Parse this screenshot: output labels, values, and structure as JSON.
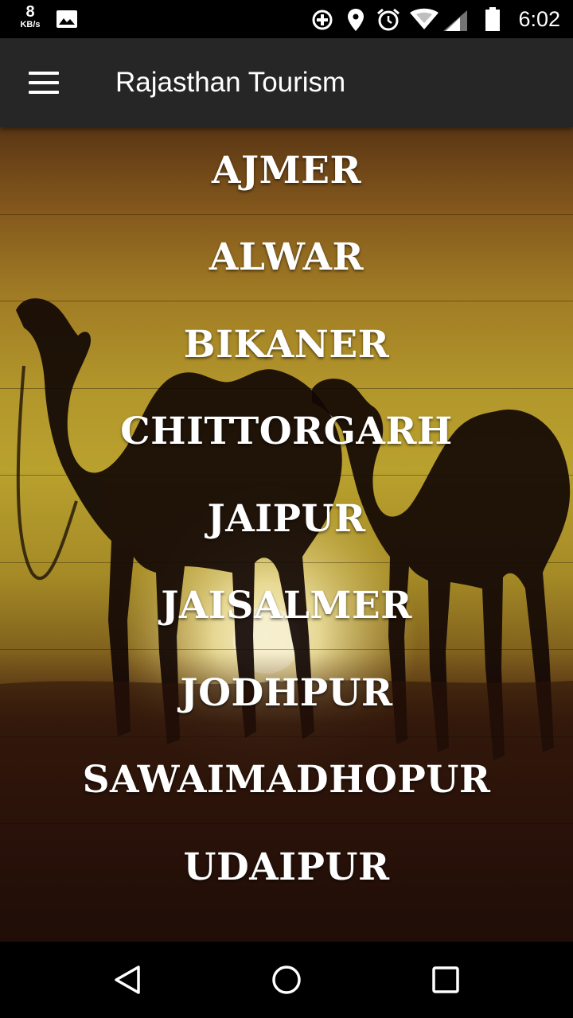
{
  "status_bar": {
    "net_speed_value": "8",
    "net_speed_unit": "KB/s",
    "time": "6:02",
    "icons": [
      "image-icon",
      "data-saver-icon",
      "location-icon",
      "alarm-icon",
      "wifi-icon",
      "signal-icon",
      "battery-icon"
    ]
  },
  "app_bar": {
    "title": "Rajasthan Tourism",
    "menu_icon": "hamburger-menu-icon"
  },
  "cities": [
    {
      "label": "AJMER"
    },
    {
      "label": "ALWAR"
    },
    {
      "label": "BIKANER"
    },
    {
      "label": "CHITTORGARH"
    },
    {
      "label": "JAIPUR"
    },
    {
      "label": "JAISALMER"
    },
    {
      "label": "JODHPUR"
    },
    {
      "label": "SAWAIMADHOPUR"
    },
    {
      "label": "UDAIPUR"
    }
  ],
  "background": {
    "description_icon": "camel-sunset-image",
    "colors": {
      "sky_top": "#5a3614",
      "sky_mid": "#b9a12e",
      "ground": "#1a0a07",
      "sun": "#f2e9c2"
    }
  },
  "nav_bar": {
    "icons": [
      "back-icon",
      "home-icon",
      "recents-icon"
    ]
  }
}
